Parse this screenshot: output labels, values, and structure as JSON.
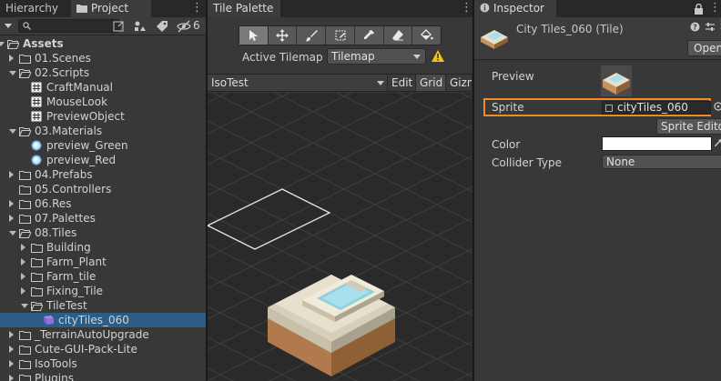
{
  "left_panel": {
    "tabs": [
      {
        "label": "Hierarchy",
        "icon": "hierarchy-icon"
      },
      {
        "label": "Project",
        "icon": "folder-icon"
      }
    ],
    "hidden_count": "6",
    "tree": [
      {
        "label": "Assets",
        "depth": 0,
        "expanded": true,
        "icon": "folder-open-icon",
        "bold": true
      },
      {
        "label": "01.Scenes",
        "depth": 1,
        "expanded": false,
        "icon": "folder-icon"
      },
      {
        "label": "02.Scripts",
        "depth": 1,
        "expanded": true,
        "icon": "folder-open-icon"
      },
      {
        "label": "CraftManual",
        "depth": 2,
        "icon": "script-icon"
      },
      {
        "label": "MouseLook",
        "depth": 2,
        "icon": "script-icon"
      },
      {
        "label": "PreviewObject",
        "depth": 2,
        "icon": "script-icon"
      },
      {
        "label": "03.Materials",
        "depth": 1,
        "expanded": true,
        "icon": "folder-open-icon"
      },
      {
        "label": "preview_Green",
        "depth": 2,
        "icon": "material-icon"
      },
      {
        "label": "preview_Red",
        "depth": 2,
        "icon": "material-icon"
      },
      {
        "label": "04.Prefabs",
        "depth": 1,
        "expanded": false,
        "icon": "folder-icon"
      },
      {
        "label": "05.Controllers",
        "depth": 1,
        "icon": "folder-icon"
      },
      {
        "label": "06.Res",
        "depth": 1,
        "expanded": false,
        "icon": "folder-icon"
      },
      {
        "label": "07.Palettes",
        "depth": 1,
        "expanded": false,
        "icon": "folder-icon"
      },
      {
        "label": "08.Tiles",
        "depth": 1,
        "expanded": true,
        "icon": "folder-open-icon"
      },
      {
        "label": "Building",
        "depth": 2,
        "expanded": false,
        "icon": "folder-icon"
      },
      {
        "label": "Farm_Plant",
        "depth": 2,
        "expanded": false,
        "icon": "folder-icon"
      },
      {
        "label": "Farm_tile",
        "depth": 2,
        "expanded": false,
        "icon": "folder-icon"
      },
      {
        "label": "Fixing_Tile",
        "depth": 2,
        "expanded": false,
        "icon": "folder-icon"
      },
      {
        "label": "TileTest",
        "depth": 2,
        "expanded": true,
        "icon": "folder-open-icon"
      },
      {
        "label": "cityTiles_060",
        "depth": 3,
        "icon": "tile-asset-icon",
        "selected": true
      },
      {
        "label": "_TerrainAutoUpgrade",
        "depth": 1,
        "expanded": false,
        "icon": "folder-icon"
      },
      {
        "label": "Cute-GUI-Pack-Lite",
        "depth": 1,
        "expanded": false,
        "icon": "folder-icon"
      },
      {
        "label": "IsoTools",
        "depth": 1,
        "expanded": false,
        "icon": "folder-icon"
      },
      {
        "label": "Plugins",
        "depth": 1,
        "expanded": false,
        "icon": "folder-icon"
      }
    ]
  },
  "tile_palette": {
    "tab": "Tile Palette",
    "tools": [
      "select-icon",
      "move-icon",
      "paint-brush-icon",
      "box-fill-icon",
      "picker-icon",
      "eraser-icon",
      "flood-fill-icon"
    ],
    "active_tool": 0,
    "active_tilemap_label": "Active Tilemap",
    "active_tilemap_value": "Tilemap",
    "palette_name": "IsoTest",
    "edit_label": "Edit",
    "grid_label": "Grid",
    "gizmos_label": "Gizmos"
  },
  "inspector": {
    "tab": "Inspector",
    "title": "City Tiles_060 (Tile)",
    "open_label": "Open",
    "preview_label": "Preview",
    "sprite_label": "Sprite",
    "sprite_value": "cityTiles_060",
    "sprite_editor_label": "Sprite Editor",
    "color_label": "Color",
    "color_value": "#ffffff",
    "collider_label": "Collider Type",
    "collider_value": "None"
  },
  "colors": {
    "selection": "#2c5d87",
    "highlight": "#f08a24",
    "warning": "#f0c419"
  }
}
